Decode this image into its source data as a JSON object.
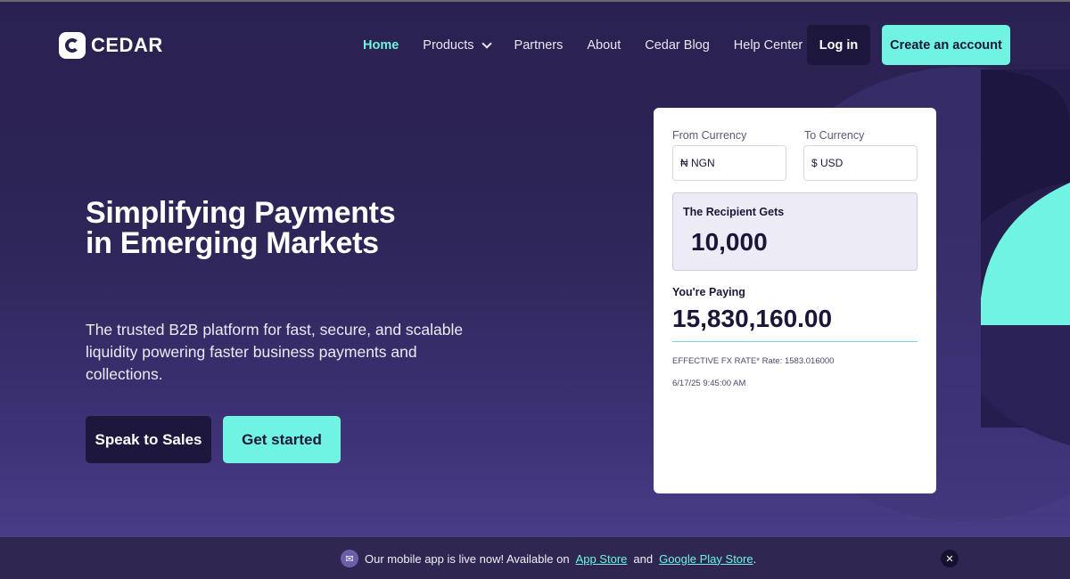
{
  "brand": {
    "name": "CEDAR"
  },
  "nav": {
    "items": [
      {
        "label": "Home",
        "active": true
      },
      {
        "label": "Products",
        "has_dropdown": true
      },
      {
        "label": "Partners"
      },
      {
        "label": "About"
      },
      {
        "label": "Cedar Blog"
      },
      {
        "label": "Help Center"
      }
    ],
    "login_label": "Log in",
    "create_label": "Create an account"
  },
  "hero": {
    "title": "Simplifying Payments in Emerging Markets",
    "subtitle": "The trusted B2B platform for fast, secure, and scalable liquidity powering faster business payments and collections.",
    "sales_label": "Speak to Sales",
    "start_label": "Get started"
  },
  "converter": {
    "from_label": "From Currency",
    "from_value": "₦ NGN",
    "to_label": "To Currency",
    "to_value": "$ USD",
    "recipient_label": "The Recipient Gets",
    "recipient_value": "10,000",
    "paying_label": "You're Paying",
    "paying_value": "15,830,160.00",
    "rate_text": "EFFECTIVE FX RATE* Rate: 1583.016000",
    "timestamp": "6/17/25  9:45:00 AM"
  },
  "banner": {
    "text_before": "Our mobile app is live now! Available on",
    "app_store": "App Store",
    "and": "and",
    "play_store": "Google Play Store",
    "end": "."
  },
  "colors": {
    "accent": "#71f3e1",
    "dark": "#1d173d",
    "background": "#2e2558"
  },
  "icons": {
    "megaphone": "megaphone-icon",
    "close": "close-icon",
    "chevron": "chevron-down-icon"
  }
}
